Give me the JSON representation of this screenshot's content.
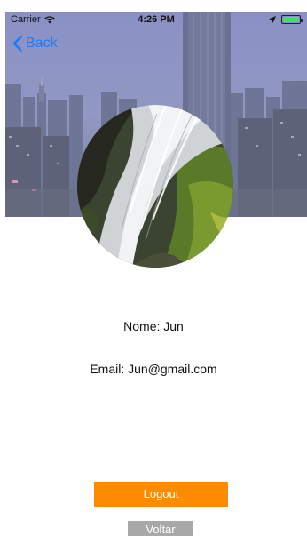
{
  "status_bar": {
    "carrier": "Carrier",
    "time": "4:26 PM",
    "wifi_icon": "wifi-icon",
    "location_icon": "location-arrow-icon",
    "battery_icon": "battery-icon",
    "battery_color": "#4cd964"
  },
  "nav": {
    "back_label": "Back",
    "back_icon": "chevron-left-icon",
    "accent_color": "#1b7cf7"
  },
  "profile": {
    "name_text": "Nome: Jun",
    "email_text": "Email: Jun@gmail.com"
  },
  "actions": {
    "logout_label": "Logout",
    "logout_color": "#fb8c00",
    "back_label": "Voltar",
    "back_color": "#a8a8a8"
  }
}
